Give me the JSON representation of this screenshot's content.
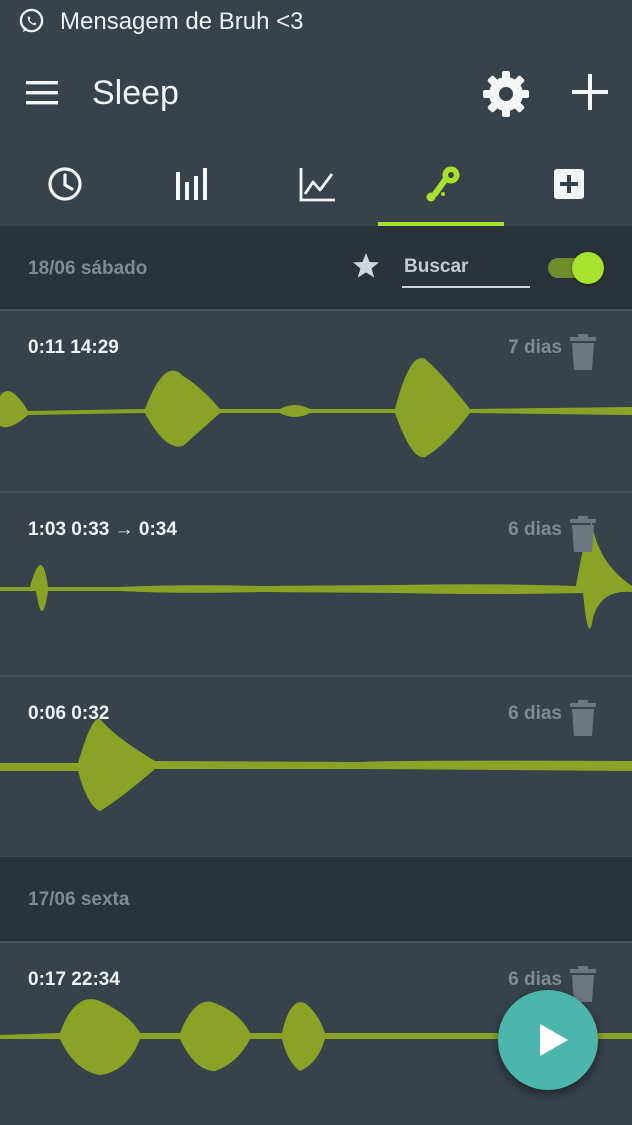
{
  "statusbar": {
    "notification": "Mensagem de Bruh <3",
    "icon": "whatsapp-icon"
  },
  "appbar": {
    "title": "Sleep",
    "icons": [
      "menu-icon",
      "gear-icon",
      "plus-icon"
    ]
  },
  "tabs": [
    {
      "icon": "clock-icon",
      "active": false
    },
    {
      "icon": "bar-chart-icon",
      "active": false
    },
    {
      "icon": "line-chart-icon",
      "active": false
    },
    {
      "icon": "recording-icon",
      "active": true
    },
    {
      "icon": "add-box-icon",
      "active": false
    }
  ],
  "groups": [
    {
      "date": "18/06 sábado",
      "search_placeholder": "Buscar",
      "favorites_toggle_on": true
    },
    {
      "date": "17/06 sexta"
    }
  ],
  "recordings": [
    {
      "time": "0:11 14:29",
      "age": "7 dias"
    },
    {
      "time": "1:03 0:33 → 0:34",
      "age": "6 dias"
    },
    {
      "time": "0:06 0:32",
      "age": "6 dias"
    },
    {
      "time": "0:17 22:34",
      "age": "6 dias"
    }
  ],
  "colors": {
    "accent": "#a6e22e",
    "wave": "#8aa326",
    "fab": "#4db6ac",
    "background": "#37424a",
    "header_band": "#2a333a"
  }
}
